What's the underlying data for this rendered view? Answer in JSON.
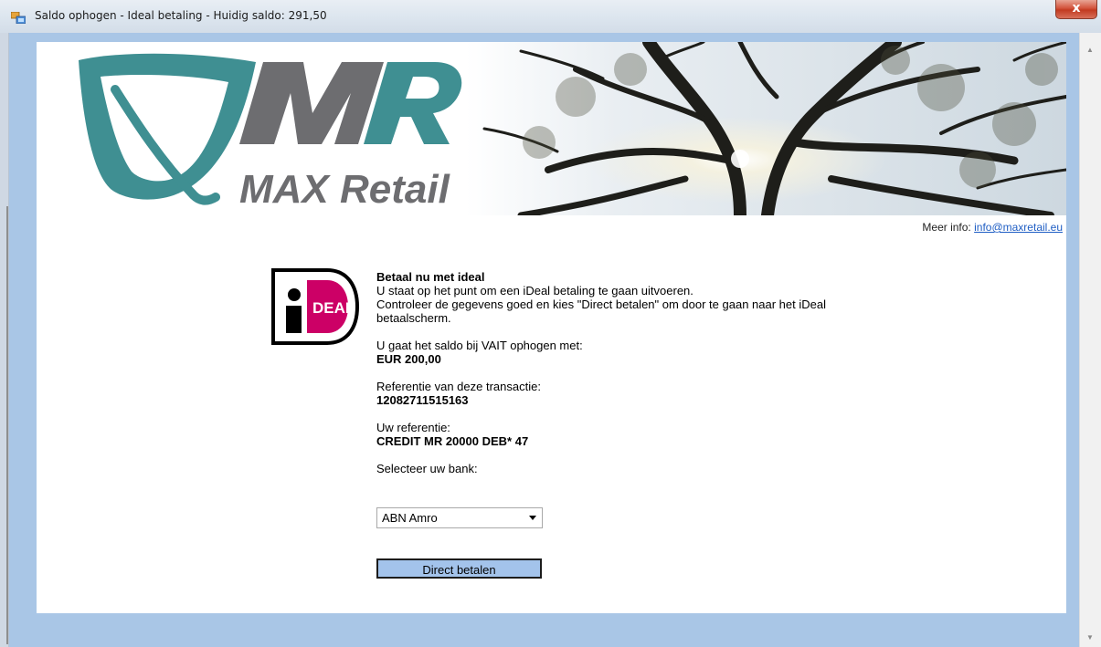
{
  "window": {
    "title": "Saldo ophogen - Ideal betaling - Huidig saldo: 291,50",
    "close_label": "x"
  },
  "header": {
    "logo_text": "MAX Retail",
    "logo_letters": "MR",
    "meer_info_label": "Meer info: ",
    "meer_info_email": "info@maxretail.eu"
  },
  "ideal_logo": {
    "text": "DEAL",
    "letter": "i"
  },
  "payment": {
    "heading": "Betaal nu met ideal",
    "intro_line1": "U staat op het punt om een iDeal betaling te gaan uitvoeren.",
    "intro_line2": "Controleer de gegevens goed en kies \"Direct betalen\" om door te gaan naar het iDeal betaalscherm.",
    "amount_label": "U gaat het saldo bij VAIT ophogen met:",
    "amount_value": "EUR 200,00",
    "reference_label": "Referentie van deze transactie:",
    "reference_value": "12082711515163",
    "your_reference_label": "Uw referentie:",
    "your_reference_value": "CREDIT MR 20000 DEB* 47",
    "bank_label": "Selecteer uw bank:",
    "bank_selected": "ABN Amro",
    "pay_button": "Direct betalen"
  },
  "colors": {
    "accent_teal": "#3f8f92",
    "logo_gray": "#6d6d70",
    "ideal_pink": "#cc0066",
    "button_blue": "#a3c3eb",
    "frame_blue": "#a9c6e6"
  }
}
